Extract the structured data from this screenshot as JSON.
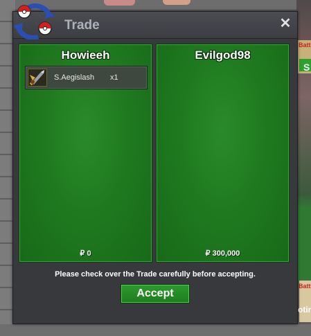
{
  "window": {
    "title": "Trade",
    "close_symbol": "✕"
  },
  "left_panel": {
    "player": "Howieeh",
    "items": [
      {
        "name": "S.Aegislash",
        "qty": "x1",
        "icon": "aegislash-icon"
      }
    ],
    "money": "₽ 0"
  },
  "right_panel": {
    "player": "Evilgod98",
    "items": [],
    "money": "₽ 300,000"
  },
  "notice": "Please check over the Trade carefully before accepting.",
  "accept_label": "Accept",
  "background": {
    "side_labels": [
      "Batt",
      "S",
      "Batt",
      "otin"
    ]
  },
  "colors": {
    "panel_green": "#1f7a1f",
    "window_bg": "#37393d",
    "accept_green": "#2f9a2f"
  }
}
